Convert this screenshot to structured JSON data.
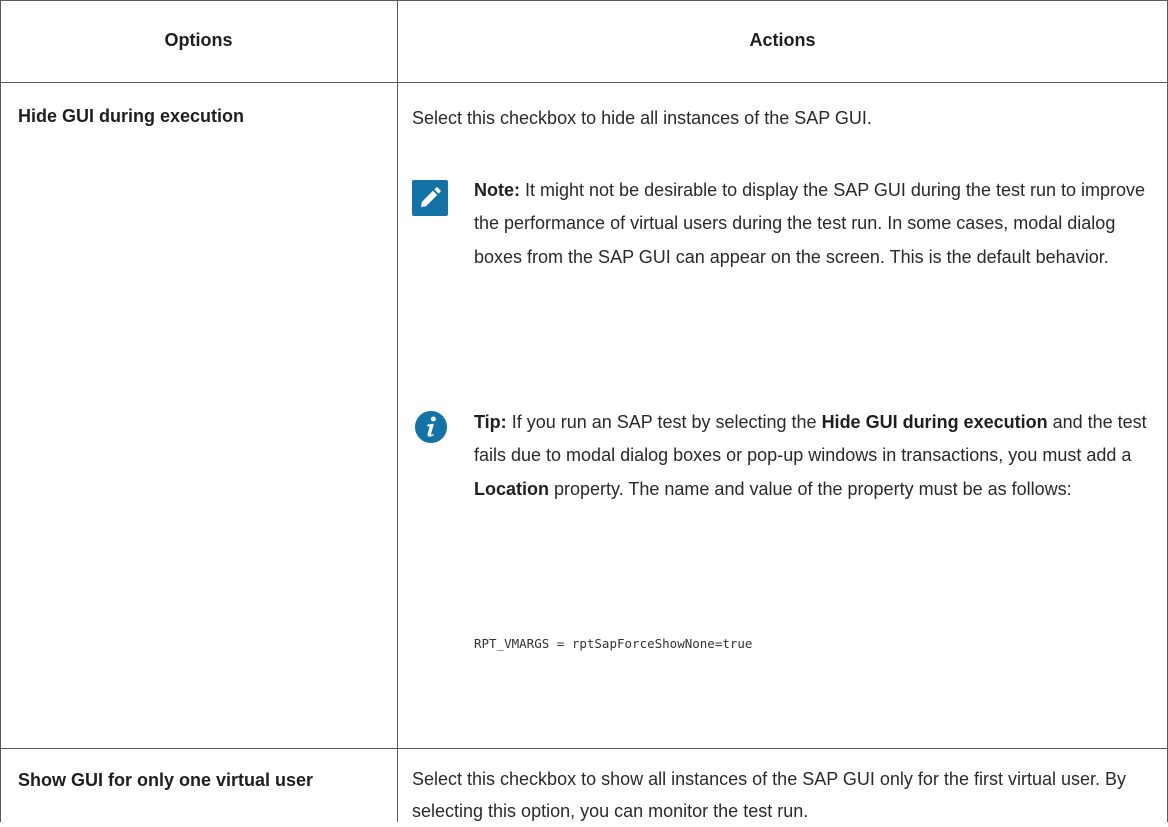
{
  "table": {
    "headers": [
      "Options",
      "Actions"
    ],
    "rows": [
      {
        "option": "Hide GUI during execution",
        "action": "Select this checkbox to hide all instances of the SAP GUI.",
        "note": {
          "icon": "pencil-icon",
          "label": "Note:",
          "text": "It might not be desirable to display the SAP GUI during the test run to improve the performance of virtual users during the test run. In some cases, modal dialog boxes from the SAP GUI can appear on the screen. This is the default behavior."
        },
        "tip": {
          "icon": "info-icon",
          "label": "Tip:",
          "t1": "If you run an SAP test by selecting the",
          "b1": "Hide GUI during execution",
          "t2": "and the test fails due to modal dialog boxes or pop-up windows in transactions, you must add a",
          "b2": "Location",
          "t3": "property. The name and value of the property must be as follows:"
        },
        "code": "RPT_VMARGS = rptSapForceShowNone=true"
      },
      {
        "option": "Show GUI for only one virtual user",
        "action": "Select this checkbox to show all instances of the SAP GUI only for the first virtual user. By selecting this option, you can monitor the test run."
      }
    ]
  },
  "colors": {
    "icon_blue": "#1473a6",
    "border": "#5a5a5a"
  }
}
